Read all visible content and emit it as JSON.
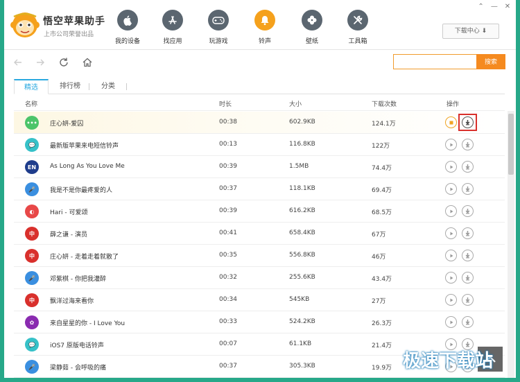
{
  "app": {
    "name": "悟空苹果助手",
    "subtitle": "上市公司荣誉出品",
    "window_controls": [
      "⌃",
      "—",
      "✕"
    ]
  },
  "nav": [
    {
      "label": "我的设备",
      "icon": "apple-icon",
      "active": false
    },
    {
      "label": "找应用",
      "icon": "app-store-icon",
      "active": false
    },
    {
      "label": "玩游戏",
      "icon": "gamepad-icon",
      "active": false
    },
    {
      "label": "铃声",
      "icon": "bell-icon",
      "active": true
    },
    {
      "label": "壁纸",
      "icon": "clover-icon",
      "active": false
    },
    {
      "label": "工具箱",
      "icon": "tools-icon",
      "active": false
    }
  ],
  "download_center": {
    "label": "下载中心 ⬇"
  },
  "search": {
    "placeholder": "",
    "value": "",
    "button_label": "搜索"
  },
  "tabs": [
    {
      "label": "精选",
      "active": true
    },
    {
      "label": "排行榜",
      "active": false
    },
    {
      "label": "分类",
      "active": false
    }
  ],
  "table": {
    "headers": {
      "name": "名称",
      "duration": "时长",
      "size": "大小",
      "downloads": "下载次数",
      "actions": "操作"
    },
    "rows": [
      {
        "icon_text": "•••",
        "icon_color": "#4cc46a",
        "name": "庄心妍-爱囚",
        "duration": "00:38",
        "size": "602.9KB",
        "downloads": "124.1万",
        "playing": true
      },
      {
        "icon_text": "💬",
        "icon_color": "#36c1c8",
        "name": "最新版苹果来电短信铃声",
        "duration": "00:13",
        "size": "116.8KB",
        "downloads": "122万",
        "playing": false
      },
      {
        "icon_text": "EN",
        "icon_color": "#1f3d8c",
        "name": "As Long As You Love Me",
        "duration": "00:39",
        "size": "1.5MB",
        "downloads": "74.4万",
        "playing": false
      },
      {
        "icon_text": "🎤",
        "icon_color": "#3a8fe0",
        "name": "我是不是你最疼爱的人",
        "duration": "00:37",
        "size": "118.1KB",
        "downloads": "69.4万",
        "playing": false
      },
      {
        "icon_text": "◐",
        "icon_color": "#e84848",
        "name": "Hari - 可爱颂",
        "duration": "00:39",
        "size": "616.2KB",
        "downloads": "68.5万",
        "playing": false
      },
      {
        "icon_text": "中",
        "icon_color": "#d9302c",
        "name": "薛之谦 - 演员",
        "duration": "00:41",
        "size": "658.4KB",
        "downloads": "67万",
        "playing": false
      },
      {
        "icon_text": "中",
        "icon_color": "#d9302c",
        "name": "庄心妍 - 走着走着就散了",
        "duration": "00:35",
        "size": "556.8KB",
        "downloads": "46万",
        "playing": false
      },
      {
        "icon_text": "🎤",
        "icon_color": "#3a8fe0",
        "name": "邓紫棋 - 你把我灌醉",
        "duration": "00:32",
        "size": "255.6KB",
        "downloads": "43.4万",
        "playing": false
      },
      {
        "icon_text": "中",
        "icon_color": "#d9302c",
        "name": "飘洋过海来看你",
        "duration": "00:34",
        "size": "545KB",
        "downloads": "27万",
        "playing": false
      },
      {
        "icon_text": "✿",
        "icon_color": "#8a2bb0",
        "name": "来自星星的你 - I Love You",
        "duration": "00:33",
        "size": "524.2KB",
        "downloads": "26.3万",
        "playing": false
      },
      {
        "icon_text": "💬",
        "icon_color": "#36c1c8",
        "name": "iOS7 原版电话铃声",
        "duration": "00:07",
        "size": "61.1KB",
        "downloads": "21.4万",
        "playing": false
      },
      {
        "icon_text": "🎤",
        "icon_color": "#3a8fe0",
        "name": "梁静茹 - 会呼吸的痛",
        "duration": "00:37",
        "size": "305.3KB",
        "downloads": "19.9万",
        "playing": false
      }
    ]
  },
  "watermark": "极速下载站",
  "colors": {
    "accent": "#f5a11c",
    "search": "#f58a1f",
    "tab_active": "#2aa9e0",
    "highlight_box": "#d9302c"
  }
}
